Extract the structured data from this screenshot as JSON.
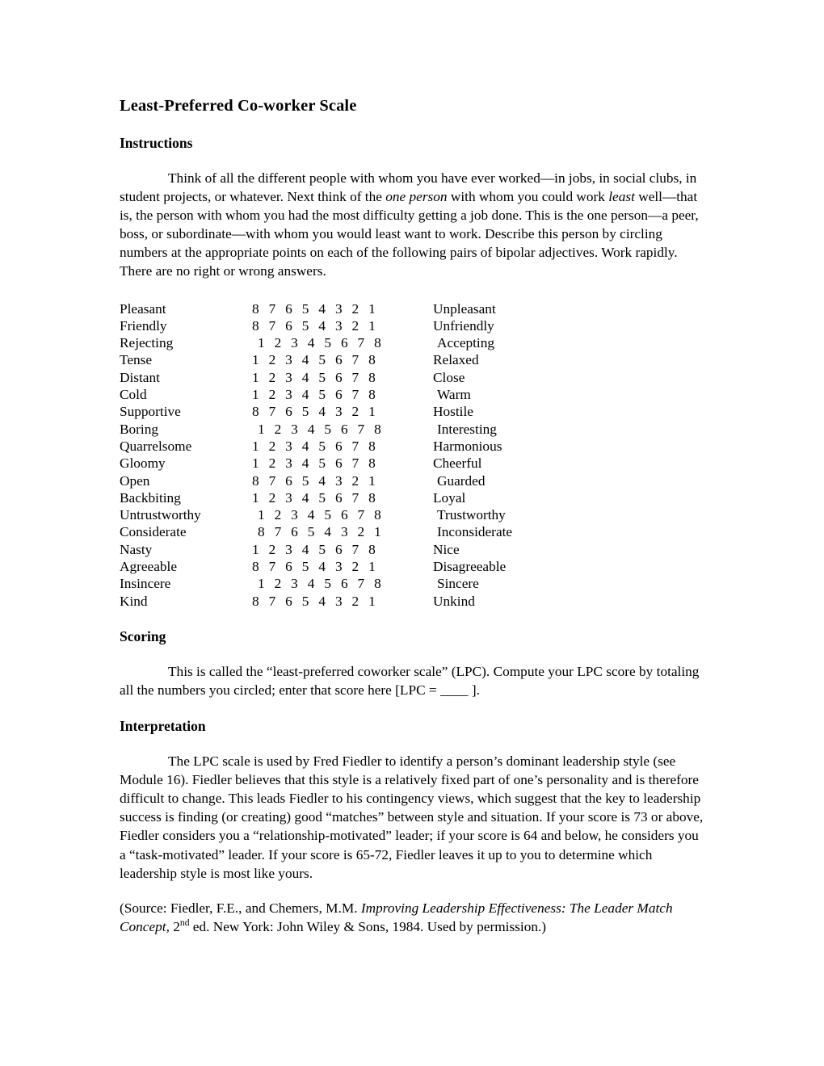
{
  "document": {
    "title": "Least-Preferred Co-worker Scale",
    "sections": {
      "instructions": {
        "heading": "Instructions",
        "paragraph_part1": "Think of all the different people with whom you have ever worked—in jobs, in social clubs, in student projects, or whatever. Next think of the ",
        "paragraph_italic1": "one person",
        "paragraph_part2": " with whom you could work ",
        "paragraph_italic2": "least",
        "paragraph_part3": " well—that is, the person with whom you had the most difficulty getting a job done. This is the one person—a peer, boss, or subordinate—with whom you would least want to work. Describe this person by circling numbers at the appropriate points on each of the following pairs of bipolar adjectives. Work rapidly. There are no right or wrong answers."
      },
      "scoring": {
        "heading": "Scoring",
        "paragraph": "This is called the “least-preferred coworker scale” (LPC). Compute your LPC score by totaling all the numbers you circled; enter that score here [LPC = ____ ]."
      },
      "interpretation": {
        "heading": "Interpretation",
        "paragraph": "The LPC scale is used by Fred Fiedler to identify a person’s dominant leadership style (see Module 16). Fiedler believes that this style is a relatively fixed part of one’s personality and is therefore difficult to change. This leads Fiedler to his contingency views, which suggest that the key to leadership success is finding (or creating) good “matches” between style and situation. If your score is 73 or above, Fiedler considers you a “relationship-motivated” leader; if your score is 64 and below, he considers you a “task-motivated” leader. If your score is 65-72, Fiedler leaves it up to you to determine which leadership style is most like yours."
      },
      "source": {
        "part1": "(Source: Fiedler, F.E., and Chemers, M.M. ",
        "italic_title": "Improving Leadership Effectiveness: The Leader Match Concept,",
        "part2": " 2",
        "superscript": "nd",
        "part3": " ed. New York: John Wiley & Sons, 1984. Used by permission.)"
      }
    },
    "scale_items": [
      {
        "left": "Pleasant",
        "numbers": [
          "8",
          "7",
          "6",
          "5",
          "4",
          "3",
          "2",
          "1"
        ],
        "right": "Unpleasant",
        "direction": "descending",
        "offset_left_label": false,
        "offset_numbers": false,
        "offset_right_label": false
      },
      {
        "left": "Friendly",
        "numbers": [
          "8",
          "7",
          "6",
          "5",
          "4",
          "3",
          "2",
          "1"
        ],
        "right": "Unfriendly",
        "direction": "descending",
        "offset_left_label": false,
        "offset_numbers": false,
        "offset_right_label": false
      },
      {
        "left": "Rejecting",
        "numbers": [
          "1",
          "2",
          "3",
          "4",
          "5",
          "6",
          "7",
          "8"
        ],
        "right": "Accepting",
        "direction": "ascending",
        "offset_left_label": false,
        "offset_numbers": true,
        "offset_right_label": true
      },
      {
        "left": "Tense",
        "numbers": [
          "1",
          "2",
          "3",
          "4",
          "5",
          "6",
          "7",
          "8"
        ],
        "right": "Relaxed",
        "direction": "ascending",
        "offset_left_label": false,
        "offset_numbers": false,
        "offset_right_label": false
      },
      {
        "left": "Distant",
        "numbers": [
          "1",
          "2",
          "3",
          "4",
          "5",
          "6",
          "7",
          "8"
        ],
        "right": "Close",
        "direction": "ascending",
        "offset_left_label": false,
        "offset_numbers": false,
        "offset_right_label": false
      },
      {
        "left": "Cold",
        "numbers": [
          "1",
          "2",
          "3",
          "4",
          "5",
          "6",
          "7",
          "8"
        ],
        "right": "Warm",
        "direction": "ascending",
        "offset_left_label": false,
        "offset_numbers": false,
        "offset_right_label": true
      },
      {
        "left": "Supportive",
        "numbers": [
          "8",
          "7",
          "6",
          "5",
          "4",
          "3",
          "2",
          "1"
        ],
        "right": "Hostile",
        "direction": "descending",
        "offset_left_label": false,
        "offset_numbers": false,
        "offset_right_label": false
      },
      {
        "left": "Boring",
        "numbers": [
          "1",
          "2",
          "3",
          "4",
          "5",
          "6",
          "7",
          "8"
        ],
        "right": "Interesting",
        "direction": "ascending",
        "offset_left_label": false,
        "offset_numbers": true,
        "offset_right_label": true
      },
      {
        "left": "Quarrelsome",
        "numbers": [
          "1",
          "2",
          "3",
          "4",
          "5",
          "6",
          "7",
          "8"
        ],
        "right": "Harmonious",
        "direction": "ascending",
        "offset_left_label": false,
        "offset_numbers": false,
        "offset_right_label": false
      },
      {
        "left": "Gloomy",
        "numbers": [
          "1",
          "2",
          "3",
          "4",
          "5",
          "6",
          "7",
          "8"
        ],
        "right": "Cheerful",
        "direction": "ascending",
        "offset_left_label": false,
        "offset_numbers": false,
        "offset_right_label": false
      },
      {
        "left": "Open",
        "numbers": [
          "8",
          "7",
          "6",
          "5",
          "4",
          "3",
          "2",
          "1"
        ],
        "right": "Guarded",
        "direction": "descending",
        "offset_left_label": false,
        "offset_numbers": false,
        "offset_right_label": true
      },
      {
        "left": "Backbiting",
        "numbers": [
          "1",
          "2",
          "3",
          "4",
          "5",
          "6",
          "7",
          "8"
        ],
        "right": "Loyal",
        "direction": "ascending",
        "offset_left_label": false,
        "offset_numbers": false,
        "offset_right_label": false
      },
      {
        "left": "Untrustworthy",
        "numbers": [
          "1",
          "2",
          "3",
          "4",
          "5",
          "6",
          "7",
          "8"
        ],
        "right": "Trustworthy",
        "direction": "ascending",
        "offset_left_label": false,
        "offset_numbers": true,
        "offset_right_label": true
      },
      {
        "left": "Considerate",
        "numbers": [
          "8",
          "7",
          "6",
          "5",
          "4",
          "3",
          "2",
          "1"
        ],
        "right": "Inconsiderate",
        "direction": "descending",
        "offset_left_label": false,
        "offset_numbers": true,
        "offset_right_label": true
      },
      {
        "left": "Nasty",
        "numbers": [
          "1",
          "2",
          "3",
          "4",
          "5",
          "6",
          "7",
          "8"
        ],
        "right": "Nice",
        "direction": "ascending",
        "offset_left_label": false,
        "offset_numbers": false,
        "offset_right_label": false
      },
      {
        "left": "Agreeable",
        "numbers": [
          "8",
          "7",
          "6",
          "5",
          "4",
          "3",
          "2",
          "1"
        ],
        "right": "Disagreeable",
        "direction": "descending",
        "offset_left_label": false,
        "offset_numbers": false,
        "offset_right_label": false
      },
      {
        "left": "Insincere",
        "numbers": [
          "1",
          "2",
          "3",
          "4",
          "5",
          "6",
          "7",
          "8"
        ],
        "right": "Sincere",
        "direction": "ascending",
        "offset_left_label": false,
        "offset_numbers": true,
        "offset_right_label": true
      },
      {
        "left": "Kind",
        "numbers": [
          "8",
          "7",
          "6",
          "5",
          "4",
          "3",
          "2",
          "1"
        ],
        "right": "Unkind",
        "direction": "descending",
        "offset_left_label": false,
        "offset_numbers": false,
        "offset_right_label": false
      }
    ]
  }
}
